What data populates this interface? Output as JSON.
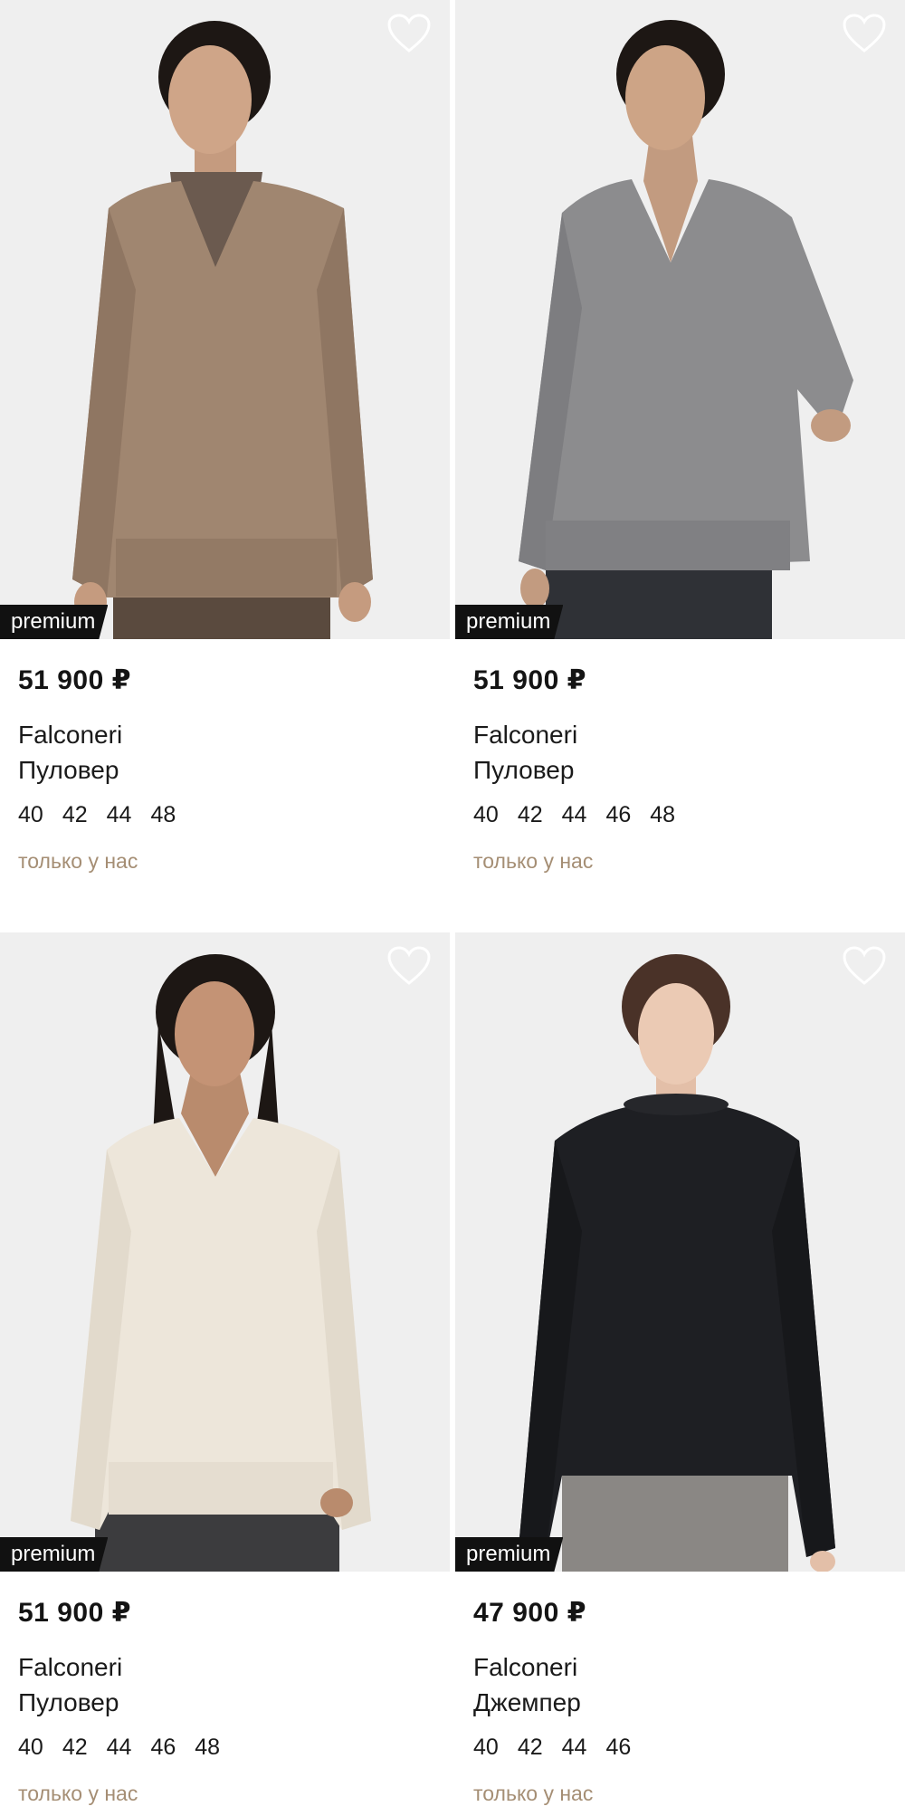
{
  "products": [
    {
      "badge": "premium",
      "price": "51 900 ₽",
      "brand": "Falconeri",
      "type": "Пуловер",
      "sizes": [
        "40",
        "42",
        "44",
        "48"
      ],
      "exclusive_label": "только у нас",
      "image": "model-in-camel-v-neck-pullover-over-brown-shirt",
      "sweater_color": "#a08670",
      "favorite_icon": "heart-outline-icon"
    },
    {
      "badge": "premium",
      "price": "51 900 ₽",
      "brand": "Falconeri",
      "type": "Пуловер",
      "sizes": [
        "40",
        "42",
        "44",
        "46",
        "48"
      ],
      "exclusive_label": "только у нас",
      "image": "model-in-grey-v-neck-pullover",
      "sweater_color": "#8c8c8e",
      "favorite_icon": "heart-outline-icon"
    },
    {
      "badge": "premium",
      "price": "51 900 ₽",
      "brand": "Falconeri",
      "type": "Пуловер",
      "sizes": [
        "40",
        "42",
        "44",
        "46",
        "48"
      ],
      "exclusive_label": "только у нас",
      "image": "model-in-cream-v-neck-pullover",
      "sweater_color": "#ede6da",
      "favorite_icon": "heart-outline-icon"
    },
    {
      "badge": "premium",
      "price": "47 900 ₽",
      "brand": "Falconeri",
      "type": "Джемпер",
      "sizes": [
        "40",
        "42",
        "44",
        "46"
      ],
      "exclusive_label": "только у нас",
      "image": "model-in-black-crew-neck-jumper",
      "sweater_color": "#1e1f23",
      "favorite_icon": "heart-outline-icon"
    }
  ],
  "colors": {
    "accent_exclusive": "#a58e74",
    "badge_bg": "#111111",
    "photo_bg": "#efefef"
  }
}
